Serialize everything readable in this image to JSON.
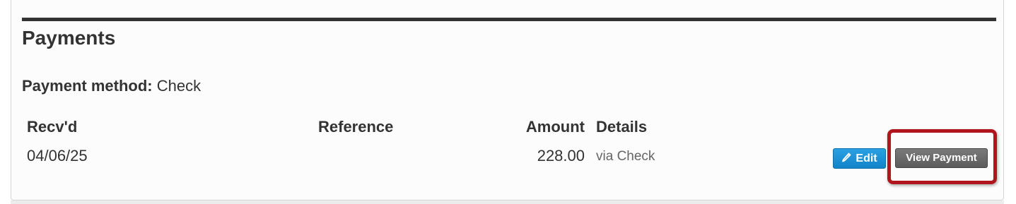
{
  "payments": {
    "title": "Payments",
    "method_label": "Payment method:",
    "method_value": "Check",
    "columns": {
      "received": "Recv'd",
      "reference": "Reference",
      "amount": "Amount",
      "details": "Details"
    },
    "rows": [
      {
        "received": "04/06/25",
        "reference": "",
        "amount": "228.00",
        "details": "via Check",
        "edit_label": "Edit",
        "view_label": "View Payment"
      }
    ]
  },
  "colors": {
    "edit_button": "#1a8fd6",
    "view_button": "#6b6b6b",
    "highlight": "#b0141c",
    "rule": "#333333"
  },
  "icons": {
    "edit": "pencil-icon"
  }
}
